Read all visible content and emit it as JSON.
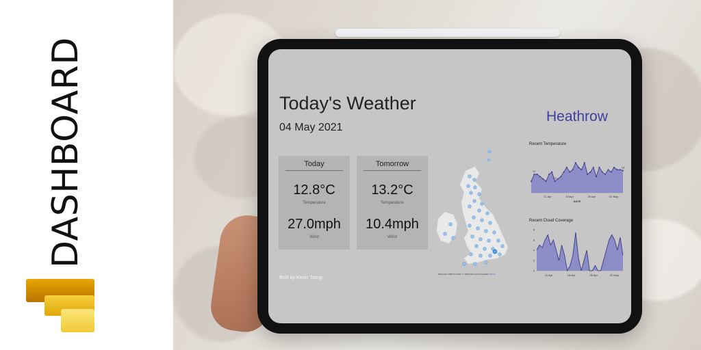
{
  "cover": {
    "vertical_title": "DASHBOARD",
    "logo": "power-bi-logo"
  },
  "dashboard": {
    "title": "Today's Weather",
    "date": "04 May 2021",
    "station": "Heathrow",
    "built_by": "Built by Kevin Tsang",
    "cards": [
      {
        "header": "Today",
        "temperature": "12.8°C",
        "temperature_label": "Temperature",
        "wind": "27.0mph",
        "wind_label": "Wind"
      },
      {
        "header": "Tomorrow",
        "temperature": "13.2°C",
        "temperature_label": "Temperature",
        "wind": "10.4mph",
        "wind_label": "Wind"
      }
    ],
    "map": {
      "attribution": "Microsoft  ©2022 TomTom, © 2022 Microsoft Corporation",
      "terms": "Terms"
    }
  },
  "colors": {
    "accent": "#3f3f9f",
    "chart_fill": "#8c8cc7",
    "chart_line": "#3b3b8a",
    "screen_bg": "#c6c6c6",
    "card_bg": "#b4b4b4"
  },
  "chart_data": [
    {
      "type": "area",
      "title": "Recent Temperature",
      "xlabel": "DATE",
      "ylabel": "",
      "x_ticks": [
        "11 Apr",
        "18 Apr",
        "25 Apr",
        "02 May"
      ],
      "ylim": [
        8,
        16
      ],
      "data_labels": [
        "12",
        "10",
        "13"
      ],
      "values": [
        10.5,
        12.0,
        12.0,
        11.5,
        11.0,
        10.5,
        12.0,
        12.5,
        10.5,
        11.0,
        11.5,
        12.5,
        13.5,
        12.5,
        13.0,
        14.5,
        13.5,
        13.0,
        14.5,
        12.0,
        12.5,
        13.5,
        11.5,
        13.5,
        12.5,
        12.0,
        13.0,
        12.5,
        13.5,
        13.0,
        13.0,
        12.8
      ]
    },
    {
      "type": "area",
      "title": "Recent Cloud Coverage",
      "xlabel": "",
      "ylabel": "",
      "x_ticks": [
        "11 Apr",
        "18 Apr",
        "25 Apr",
        "02 May"
      ],
      "ylim": [
        0,
        8
      ],
      "y_ticks": [
        "0",
        "2",
        "4",
        "6",
        "8"
      ],
      "values": [
        4,
        5,
        4.5,
        6,
        7,
        5,
        6,
        4,
        2,
        5,
        3,
        0,
        1,
        3,
        7.5,
        2.5,
        0,
        2,
        4,
        0,
        0,
        1,
        0,
        0,
        2,
        4,
        6,
        7,
        6,
        4,
        6.5,
        3
      ]
    }
  ]
}
